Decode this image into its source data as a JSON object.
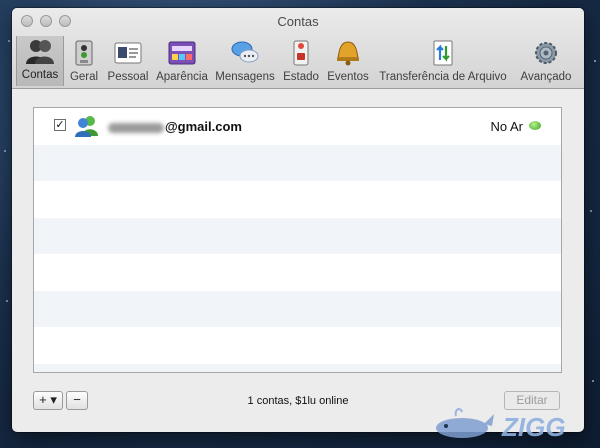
{
  "window": {
    "title": "Contas"
  },
  "toolbar": [
    {
      "label": "Contas",
      "icon": "accounts-icon",
      "selected": true
    },
    {
      "label": "Geral",
      "icon": "general-icon"
    },
    {
      "label": "Pessoal",
      "icon": "personal-icon"
    },
    {
      "label": "Aparência",
      "icon": "appearance-icon"
    },
    {
      "label": "Mensagens",
      "icon": "messages-icon"
    },
    {
      "label": "Estado",
      "icon": "status-icon"
    },
    {
      "label": "Eventos",
      "icon": "events-icon"
    },
    {
      "label": "Transferência de Arquivo",
      "icon": "file-transfer-icon"
    },
    {
      "label": "Avançado",
      "icon": "advanced-icon"
    }
  ],
  "accounts": [
    {
      "enabled_mark": "✓",
      "email_visible": "@gmail.com",
      "status": "No Ar",
      "status_color": "#3fae1f"
    }
  ],
  "footer": {
    "add_label": "+ ▾",
    "remove_label": "−",
    "summary": "1 contas, $1lu online",
    "edit_label": "Editar"
  },
  "watermark": {
    "text": "ZIGG"
  }
}
